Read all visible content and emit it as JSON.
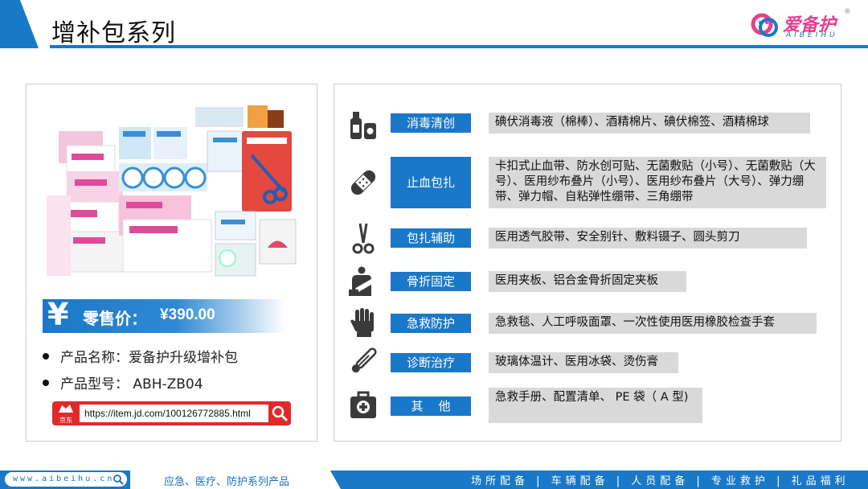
{
  "header": {
    "title": "增补包系列"
  },
  "logo": {
    "name_zh": "爱备护",
    "name_en": "AIBEIHU",
    "reg": "®"
  },
  "product": {
    "price_symbol": "¥",
    "price_label": "零售价：",
    "price_value": "¥390.00",
    "name_line": "产品名称：爱备护升级增补包",
    "model_line": "产品型号： ABH-ZB04",
    "jd_label": "京东",
    "url": "https://item.jd.com/100126772885.html"
  },
  "categories": [
    {
      "label": "消毒清创",
      "icon": "bottles-icon",
      "desc": "碘伏消毒液（棉棒）、酒精棉片、碘伏棉签、酒精棉球"
    },
    {
      "label": "止血包扎",
      "icon": "bandage-icon",
      "desc": "卡扣式止血带、防水创可贴、无菌敷贴（小号）、无菌敷贴（大号）、医用纱布叠片（小号）、医用纱布叠片（大号）、弹力绷带、弹力帽、自粘弹性绷带、三角绷带"
    },
    {
      "label": "包扎辅助",
      "icon": "scissors-icon",
      "desc": "医用透气胶带、安全别针、敷料镊子、圆头剪刀"
    },
    {
      "label": "骨折固定",
      "icon": "splint-icon",
      "desc": "医用夹板、铝合金骨折固定夹板"
    },
    {
      "label": "急救防护",
      "icon": "glove-icon",
      "desc": "急救毯、人工呼吸面罩、一次性使用医用橡胶检查手套"
    },
    {
      "label": "诊断治疗",
      "icon": "thermometer-icon",
      "desc": "玻璃体温计、医用冰袋、烫伤膏"
    },
    {
      "label": "其    他",
      "icon": "first-aid-kit-icon",
      "desc": "急救手册、配置清单、 PE 袋（ A 型)"
    }
  ],
  "footer": {
    "site": "www.aibeihu.cn",
    "slogan": "应急、医疗、防护系列产品",
    "tags": "场所配备 | 车辆配备 | 人员配备 | 专业救护 | 礼品福利"
  },
  "colors": {
    "brand_blue": "#1a78c8",
    "brand_pink": "#e63f8e",
    "desc_gray": "#d9d9d9",
    "jd_red": "#e02a2a"
  }
}
